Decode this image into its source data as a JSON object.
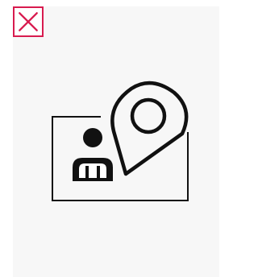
{
  "close_button": {
    "icon": "close-icon",
    "color": "#d81b4f"
  },
  "illustration": {
    "icons": [
      "id-card-icon",
      "person-icon",
      "location-pin-icon"
    ],
    "stroke_color": "#111111"
  }
}
